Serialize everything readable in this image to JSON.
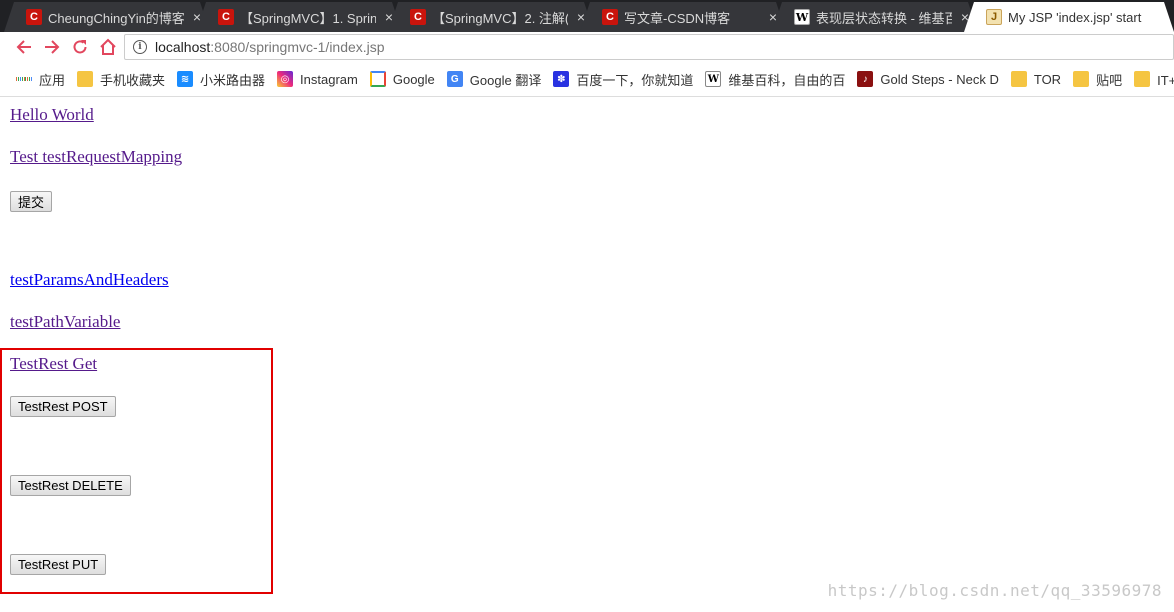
{
  "tabs": [
    {
      "favicon": "csdn-icon",
      "title": "CheungChingYin的博客",
      "active": false
    },
    {
      "favicon": "csdn-icon",
      "title": "【SpringMVC】1. Sprin",
      "active": false
    },
    {
      "favicon": "csdn-icon",
      "title": "【SpringMVC】2. 注解(",
      "active": false
    },
    {
      "favicon": "csdn-icon",
      "title": "写文章-CSDN博客",
      "active": false
    },
    {
      "favicon": "wiki-icon",
      "title": "表现层状态转换 - 维基百",
      "active": false
    },
    {
      "favicon": "jsp-icon",
      "title": "My JSP 'index.jsp' start",
      "active": true
    }
  ],
  "close_glyph": "×",
  "toolbar": {
    "url_host": "localhost",
    "url_path": ":8080/springmvc-1/index.jsp"
  },
  "bookmarks": [
    {
      "icon": "apps-icon",
      "label": "应用"
    },
    {
      "icon": "folder-icon",
      "label": "手机收藏夹"
    },
    {
      "icon": "wifi-icon",
      "label": "小米路由器"
    },
    {
      "icon": "instagram-icon",
      "label": "Instagram"
    },
    {
      "icon": "google-icon",
      "label": "Google"
    },
    {
      "icon": "google-translate-icon",
      "label": "Google 翻译"
    },
    {
      "icon": "baidu-icon",
      "label": "百度一下，你就知道"
    },
    {
      "icon": "wikipedia-icon",
      "label": "维基百科，自由的百"
    },
    {
      "icon": "music-icon",
      "label": "Gold Steps - Neck D"
    },
    {
      "icon": "folder-icon",
      "label": "TOR"
    },
    {
      "icon": "folder-icon",
      "label": "贴吧"
    },
    {
      "icon": "folder-icon",
      "label": "IT+暴恐"
    }
  ],
  "page": {
    "hello_world": "Hello World",
    "test_request_mapping": "Test testRequestMapping",
    "submit": "提交",
    "test_params_and_headers": "testParamsAndHeaders",
    "test_path_variable": "testPathVariable",
    "test_rest_get": "TestRest Get",
    "test_rest_post": "TestRest POST",
    "test_rest_delete": "TestRest DELETE",
    "test_rest_put": "TestRest PUT"
  },
  "watermark": "https://blog.csdn.net/qq_33596978",
  "colors": {
    "highlight_box": "#e10000",
    "visited_link": "#551a8b",
    "link": "#0000ee"
  }
}
